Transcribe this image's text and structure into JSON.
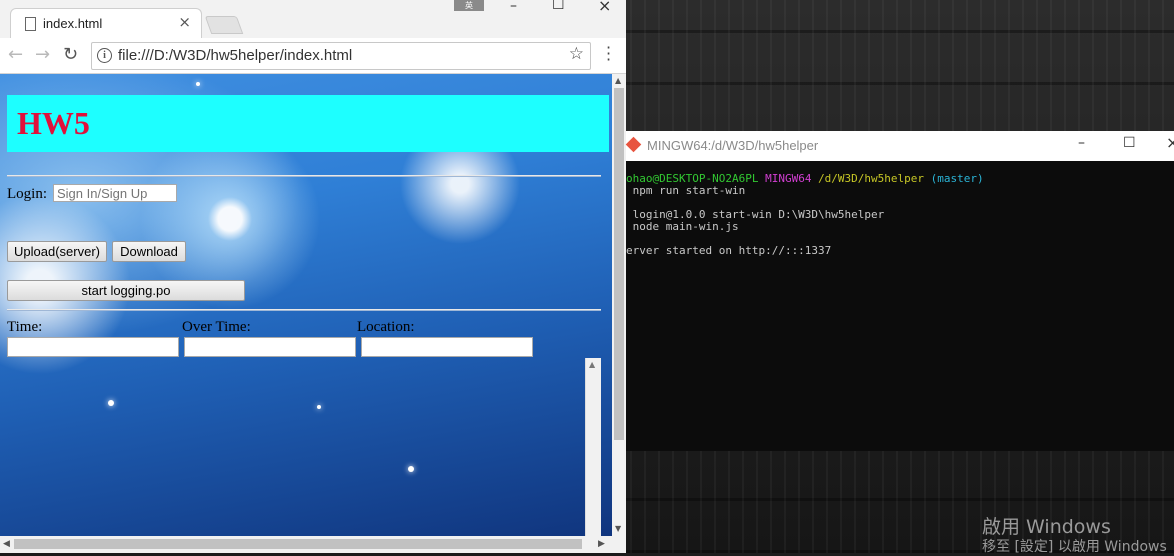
{
  "browser": {
    "tab_title": "index.html",
    "url": "file:///D:/W3D/hw5helper/index.html",
    "ime_indicator": "英"
  },
  "page": {
    "heading": "HW5",
    "login_label": "Login:",
    "login_placeholder": "Sign In/Sign Up",
    "upload_button": "Upload(server)",
    "download_button": "Download",
    "start_logging_button": "start logging.po",
    "time_label": "Time:",
    "over_time_label": "Over Time:",
    "location_label": "Location:"
  },
  "terminal": {
    "title": "MINGW64:/d/W3D/hw5helper",
    "prompt_user": "ohao@DESKTOP-NO2A6PL",
    "prompt_env": "MINGW64",
    "prompt_path": "/d/W3D/hw5helper",
    "prompt_branch": "(master)",
    "lines": [
      " npm run start-win",
      " login@1.0.0 start-win D:\\W3D\\hw5helper",
      " node main-win.js",
      "erver started on http://:::1337"
    ]
  },
  "watermark": {
    "line1": "啟用 Windows",
    "line2": "移至 [設定] 以啟用 Windows"
  },
  "colors": {
    "banner": "#1dffff",
    "heading": "#e0103b",
    "terminal_bg": "#0c0c0c"
  }
}
